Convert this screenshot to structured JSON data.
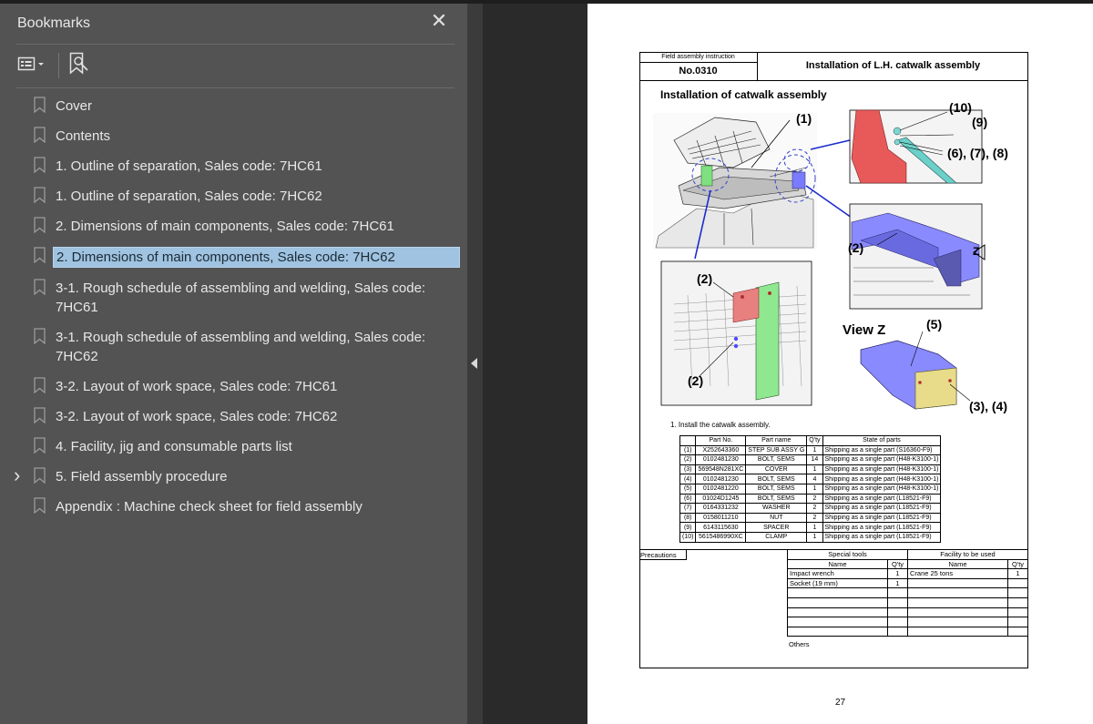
{
  "sidebar": {
    "title": "Bookmarks",
    "close_glyph": "✕",
    "options_icon": "list-options-icon",
    "find_bookmark_icon": "bookmark-search-icon",
    "items": [
      {
        "label": "Cover",
        "expandable": false,
        "selected": false
      },
      {
        "label": "Contents",
        "expandable": false,
        "selected": false
      },
      {
        "label": "1.  Outline of separation, Sales code: 7HC61",
        "expandable": false,
        "selected": false
      },
      {
        "label": "1.  Outline of separation, Sales code: 7HC62",
        "expandable": false,
        "selected": false
      },
      {
        "label": "2. Dimensions of main components, Sales code: 7HC61",
        "expandable": false,
        "selected": false
      },
      {
        "label": "2. Dimensions of main components, Sales code: 7HC62",
        "expandable": false,
        "selected": true
      },
      {
        "label": "3-1. Rough schedule of assembling and welding, Sales code: 7HC61",
        "expandable": false,
        "selected": false
      },
      {
        "label": "3-1. Rough schedule of assembling and welding, Sales code: 7HC62",
        "expandable": false,
        "selected": false
      },
      {
        "label": "3-2. Layout of work space, Sales code: 7HC61",
        "expandable": false,
        "selected": false
      },
      {
        "label": "3-2. Layout of work space, Sales code: 7HC62",
        "expandable": false,
        "selected": false
      },
      {
        "label": "4. Facility, jig and consumable parts list",
        "expandable": false,
        "selected": false
      },
      {
        "label": "5. Field assembly procedure",
        "expandable": true,
        "selected": false
      },
      {
        "label": "Appendix : Machine check sheet for field assembly",
        "expandable": false,
        "selected": false
      }
    ]
  },
  "colors": {
    "sidebar_bg": "#535353",
    "selected_bg": "#9fc3e0",
    "doc_bg": "#2a2a2a",
    "part_highlight_blue": "#7b7bff",
    "part_highlight_green": "#7fe07f",
    "part_highlight_red": "#e85a5a"
  },
  "page": {
    "header_small": "Field assembly instruction",
    "doc_number": "No.0310",
    "doc_title": "Installation of L.H. catwalk assembly",
    "section_title": "Installation of catwalk assembly",
    "callouts": {
      "c1": "(1)",
      "c10": "(10)",
      "c9": "(9)",
      "c678": "(6), (7), (8)",
      "c2a": "(2)",
      "z": "Z",
      "c2b": "(2)",
      "c2c": "(2)",
      "view_z": "View Z",
      "c5": "(5)",
      "c34": "(3), (4)"
    },
    "install_note": "1. Install the catwalk assembly.",
    "parts_headers": [
      "",
      "Part No.",
      "Part name",
      "Q'ty",
      "State of parts"
    ],
    "parts": [
      [
        "(1)",
        "X252643360",
        "STEP SUB ASSY G",
        "1",
        "Shipping as a single part (S16360-F9)"
      ],
      [
        "(2)",
        "0102481230",
        "BOLT, SEMS",
        "14",
        "Shipping as a single part (H48-K3100-1)"
      ],
      [
        "(3)",
        "569548N281XC",
        "COVER",
        "1",
        "Shipping as a single part (H48-K3100-1)"
      ],
      [
        "(4)",
        "0102481230",
        "BOLT, SEMS",
        "4",
        "Shipping as a single part (H48-K3100-1)"
      ],
      [
        "(5)",
        "0102481220",
        "BOLT, SEMS",
        "1",
        "Shipping as a single part (H48-K3100-1)"
      ],
      [
        "(6)",
        "01024D1245",
        "BOLT, SEMS",
        "2",
        "Shipping as a single part (L18521-F9)"
      ],
      [
        "(7)",
        "0164331232",
        "WASHER",
        "2",
        "Shipping as a single part (L18521-F9)"
      ],
      [
        "(8)",
        "0158011210",
        "NUT",
        "2",
        "Shipping as a single part (L18521-F9)"
      ],
      [
        "(9)",
        "6143115630",
        "SPACER",
        "1",
        "Shipping as a single part (L18521-F9)"
      ],
      [
        "(10)",
        "5615486990XC",
        "CLAMP",
        "1",
        "Shipping as a single part (L18521-F9)"
      ]
    ],
    "precautions_label": "Precautions",
    "special_tools_label": "Special tools",
    "facility_label": "Facility to be used",
    "col_name": "Name",
    "col_qty": "Q'ty",
    "tools": [
      [
        "Impact wrench",
        "1",
        "Crane 25 tons",
        "1"
      ],
      [
        "Socket (19 mm)",
        "1",
        "",
        ""
      ],
      [
        "",
        "",
        "",
        ""
      ],
      [
        "",
        "",
        "",
        ""
      ],
      [
        "",
        "",
        "",
        ""
      ],
      [
        "",
        "",
        "",
        ""
      ],
      [
        "",
        "",
        "",
        ""
      ]
    ],
    "others_label": "Others",
    "page_number": "27"
  }
}
